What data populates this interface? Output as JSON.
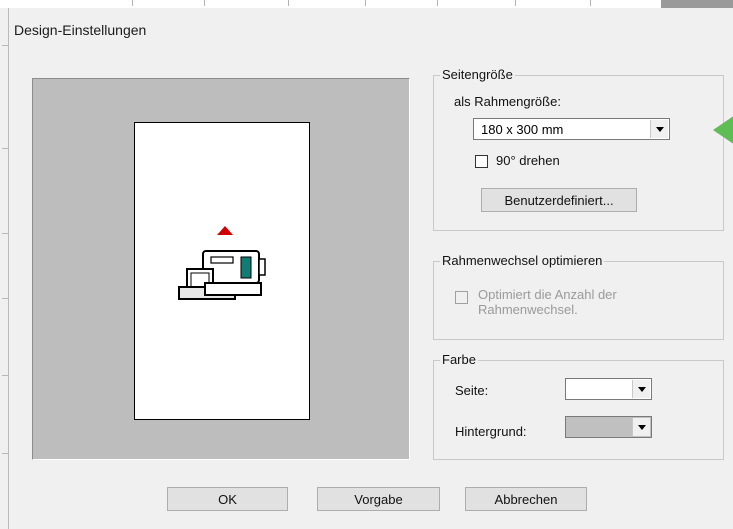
{
  "dialog": {
    "title": "Design-Einstellungen"
  },
  "page_size": {
    "legend": "Seitengröße",
    "frame_label": "als Rahmengröße:",
    "frame_value": "180 x 300 mm",
    "rotate_label": "90° drehen",
    "rotate_checked": false,
    "custom_button": "Benutzerdefiniert..."
  },
  "frame_change": {
    "legend": "Rahmenwechsel optimieren",
    "optimize_line1": "Optimiert die Anzahl der",
    "optimize_line2": "Rahmenwechsel.",
    "optimize_enabled": false
  },
  "color": {
    "legend": "Farbe",
    "page_label": "Seite:",
    "page_color": "#ffffff",
    "background_label": "Hintergrund:",
    "background_color": "#c0c0c0"
  },
  "buttons": {
    "ok": "OK",
    "default": "Vorgabe",
    "cancel": "Abbrechen"
  },
  "colors": {
    "preview_bg": "#bdbdbd",
    "hint_arrow": "#5fbd56",
    "orientation_marker": "#d10000"
  },
  "icons": {
    "machine": "embroidery-machine-icon",
    "arrow": "orientation-arrow-icon",
    "hint": "green-arrow-icon"
  }
}
